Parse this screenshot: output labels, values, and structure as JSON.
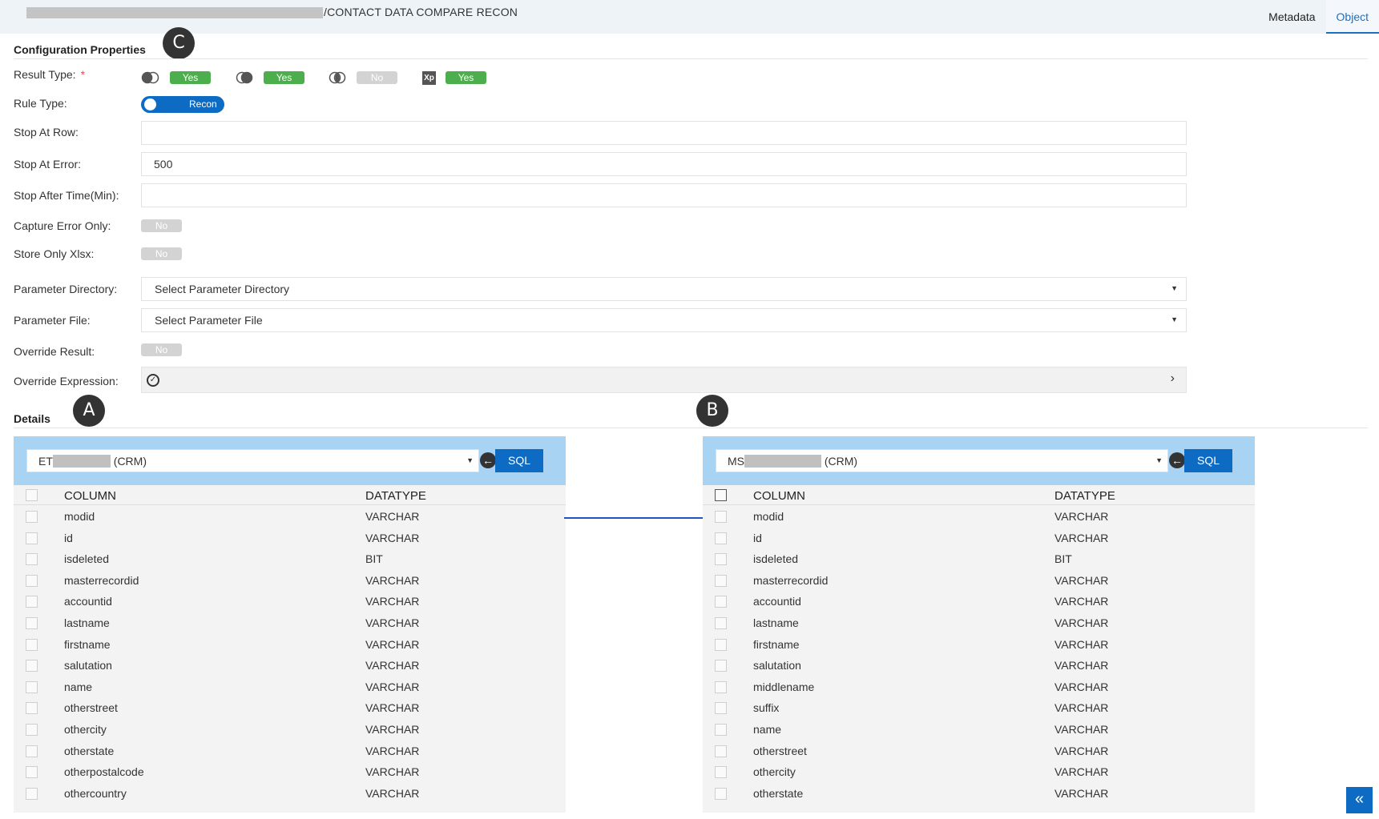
{
  "header": {
    "title": "/CONTACT DATA COMPARE RECON",
    "tabs": [
      {
        "label": "Metadata",
        "active": false
      },
      {
        "label": "Object",
        "active": true
      }
    ]
  },
  "markers": {
    "a": "A",
    "b": "B",
    "c": "C"
  },
  "config": {
    "title": "Configuration Properties",
    "result_type": {
      "label": "Result Type:",
      "required_mark": "*",
      "options": [
        {
          "icon": "left-join-icon",
          "value": "Yes"
        },
        {
          "icon": "right-join-icon",
          "value": "Yes"
        },
        {
          "icon": "inner-join-icon",
          "value": "No"
        },
        {
          "icon": "xp-icon",
          "icon_text": "Xp",
          "value": "Yes"
        }
      ]
    },
    "rule_type": {
      "label": "Rule Type:",
      "value": "Recon"
    },
    "stop_at_row": {
      "label": "Stop At Row:",
      "value": ""
    },
    "stop_at_error": {
      "label": "Stop At Error:",
      "value": "500"
    },
    "stop_after_time": {
      "label": "Stop After Time(Min):",
      "value": ""
    },
    "capture_error_only": {
      "label": "Capture Error Only:",
      "value": "No"
    },
    "store_only_xlsx": {
      "label": "Store Only Xlsx:",
      "value": "No"
    },
    "parameter_directory": {
      "label": "Parameter Directory:",
      "value": "Select Parameter Directory"
    },
    "parameter_file": {
      "label": "Parameter File:",
      "value": "Select Parameter File"
    },
    "override_result": {
      "label": "Override Result:",
      "value": "No"
    },
    "override_expression": {
      "label": "Override Expression:"
    }
  },
  "details": {
    "title": "Details",
    "sql_label": "SQL",
    "left": {
      "source_prefix": "ET",
      "source_suffix": " (CRM)",
      "col_header": "COLUMN",
      "type_header": "DATATYPE",
      "rows": [
        [
          "modid",
          "VARCHAR"
        ],
        [
          "id",
          "VARCHAR"
        ],
        [
          "isdeleted",
          "BIT"
        ],
        [
          "masterrecordid",
          "VARCHAR"
        ],
        [
          "accountid",
          "VARCHAR"
        ],
        [
          "lastname",
          "VARCHAR"
        ],
        [
          "firstname",
          "VARCHAR"
        ],
        [
          "salutation",
          "VARCHAR"
        ],
        [
          "name",
          "VARCHAR"
        ],
        [
          "otherstreet",
          "VARCHAR"
        ],
        [
          "othercity",
          "VARCHAR"
        ],
        [
          "otherstate",
          "VARCHAR"
        ],
        [
          "otherpostalcode",
          "VARCHAR"
        ],
        [
          "othercountry",
          "VARCHAR"
        ]
      ]
    },
    "right": {
      "source_prefix": "MS",
      "source_suffix": " (CRM)",
      "col_header": "COLUMN",
      "type_header": "DATATYPE",
      "rows": [
        [
          "modid",
          "VARCHAR"
        ],
        [
          "id",
          "VARCHAR"
        ],
        [
          "isdeleted",
          "BIT"
        ],
        [
          "masterrecordid",
          "VARCHAR"
        ],
        [
          "accountid",
          "VARCHAR"
        ],
        [
          "lastname",
          "VARCHAR"
        ],
        [
          "firstname",
          "VARCHAR"
        ],
        [
          "salutation",
          "VARCHAR"
        ],
        [
          "middlename",
          "VARCHAR"
        ],
        [
          "suffix",
          "VARCHAR"
        ],
        [
          "name",
          "VARCHAR"
        ],
        [
          "otherstreet",
          "VARCHAR"
        ],
        [
          "othercity",
          "VARCHAR"
        ],
        [
          "otherstate",
          "VARCHAR"
        ]
      ]
    }
  },
  "colors": {
    "accent": "#0e6bc3",
    "yes": "#4cae4c",
    "no": "#d3d3d3",
    "panel_head": "#a9d3f2",
    "link": "#1f54c5"
  }
}
